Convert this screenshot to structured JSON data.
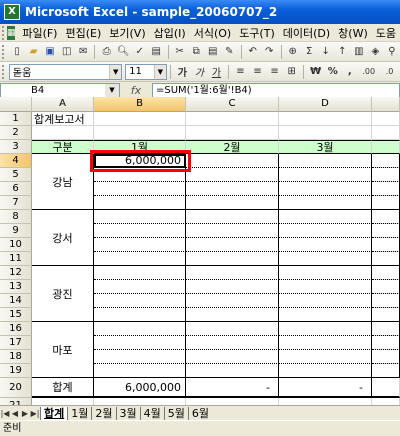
{
  "window": {
    "title": "Microsoft Excel - sample_20060707_2",
    "app_icon": "X"
  },
  "menu": {
    "items": [
      "파일(F)",
      "편집(E)",
      "보기(V)",
      "삽입(I)",
      "서식(O)",
      "도구(T)",
      "데이터(D)",
      "창(W)",
      "도움"
    ]
  },
  "toolbar": {
    "font_name": "돋움",
    "font_size": "11",
    "bold": "가",
    "italic": "가",
    "underline": "가",
    "currency": "₩",
    "percent": "%",
    "comma": ",",
    "sum": "Σ",
    "increase_decimal": ".00",
    "decrease_decimal": ".0"
  },
  "formula_bar": {
    "name_box": "B4",
    "fx": "fx",
    "formula": "=SUM('1월:6월'!B4)"
  },
  "columns": [
    "A",
    "B",
    "C",
    "D"
  ],
  "rows": [
    "1",
    "2",
    "3",
    "4",
    "5",
    "6",
    "7",
    "8",
    "9",
    "10",
    "11",
    "12",
    "13",
    "14",
    "15",
    "16",
    "17",
    "18",
    "19",
    "20",
    "21"
  ],
  "sheet": {
    "title": "합계보고서",
    "header": [
      "구분",
      "1월",
      "2월",
      "3월"
    ],
    "regions": [
      "강남",
      "강서",
      "광진",
      "마포"
    ],
    "b4_value": "6,000,000",
    "total_label": "합계",
    "total_b": "6,000,000",
    "total_c": "-",
    "total_d": "-"
  },
  "tabs": {
    "nav": [
      "|◀",
      "◀",
      "▶",
      "▶|"
    ],
    "items": [
      "합계",
      "1월",
      "2월",
      "3월",
      "4월",
      "5월",
      "6월"
    ],
    "active": 0
  },
  "status": {
    "text": "준비"
  },
  "colors": {
    "header_fill": "#ccffcc",
    "highlight": "#ff0000",
    "titlebar": "#0a5fd8"
  }
}
